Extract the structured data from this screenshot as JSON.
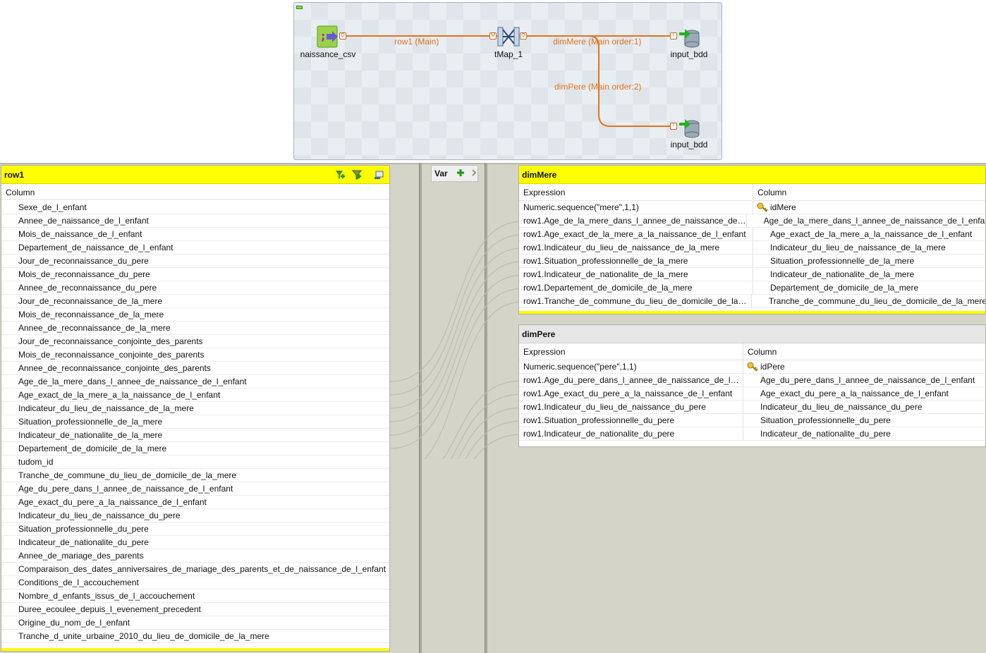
{
  "designer": {
    "components": [
      {
        "id": "naissance_csv",
        "label": "naissance_csv",
        "icon": "file-input-icon"
      },
      {
        "id": "tmap",
        "label": "tMap_1",
        "icon": "tmap-icon"
      },
      {
        "id": "out1",
        "label": "input_bdd",
        "icon": "database-output-icon"
      },
      {
        "id": "out2",
        "label": "input_bdd",
        "icon": "database-output-icon"
      }
    ],
    "links": [
      {
        "label": "row1 (Main)"
      },
      {
        "label": "dimMere (Main order:1)"
      },
      {
        "label": "dimPere (Main order:2)"
      }
    ],
    "ports": {
      "out_csv": "O",
      "in_tmap": "M",
      "out_tmap": "O",
      "in_out1": "I",
      "in_out2": "I"
    }
  },
  "input_table": {
    "title": "row1",
    "column_header": "Column",
    "rows": [
      "Sexe_de_l_enfant",
      "Annee_de_naissance_de_l_enfant",
      "Mois_de_naissance_de_l_enfant",
      "Departement_de_naissance_de_l_enfant",
      "Jour_de_reconnaissance_du_pere",
      "Mois_de_reconnaissance_du_pere",
      "Annee_de_reconnaissance_du_pere",
      "Jour_de_reconnaissance_de_la_mere",
      "Mois_de_reconnaissance_de_la_mere",
      "Annee_de_reconnaissance_de_la_mere",
      "Jour_de_reconnaissance_conjointe_des_parents",
      "Mois_de_reconnaissance_conjointe_des_parents",
      "Annee_de_reconnaissance_conjointe_des_parents",
      "Age_de_la_mere_dans_l_annee_de_naissance_de_l_enfant",
      "Age_exact_de_la_mere_a_la_naissance_de_l_enfant",
      "Indicateur_du_lieu_de_naissance_de_la_mere",
      "Situation_professionnelle_de_la_mere",
      "Indicateur_de_nationalite_de_la_mere",
      "Departement_de_domicile_de_la_mere",
      "tudom_id",
      "Tranche_de_commune_du_lieu_de_domicile_de_la_mere",
      "Age_du_pere_dans_l_annee_de_naissance_de_l_enfant",
      "Age_exact_du_pere_a_la_naissance_de_l_enfant",
      "Indicateur_du_lieu_de_naissance_du_pere",
      "Situation_professionnelle_du_pere",
      "Indicateur_de_nationalite_du_pere",
      "Annee_de_mariage_des_parents",
      "Comparaison_des_dates_anniversaires_de_mariage_des_parents_et_de_naissance_de_l_enfant",
      "Conditions_de_l_accouchement",
      "Nombre_d_enfants_issus_de_l_accouchement",
      "Duree_ecoulee_depuis_l_evenement_precedent",
      "Origine_du_nom_de_l_enfant",
      "Tranche_d_unite_urbaine_2010_du_lieu_de_domicile_de_la_mere"
    ]
  },
  "var_panel": {
    "title": "Var"
  },
  "output_tables": [
    {
      "title": "dimMere",
      "expression_header": "Expression",
      "column_header": "Column",
      "rows": [
        {
          "expr": "Numeric.sequence(\"mere\",1,1)",
          "col": "idMere",
          "key": true
        },
        {
          "expr": "row1.Age_de_la_mere_dans_l_annee_de_naissance_de_l_en...",
          "col": "Age_de_la_mere_dans_l_annee_de_naissance_de_l_enfant"
        },
        {
          "expr": "row1.Age_exact_de_la_mere_a_la_naissance_de_l_enfant",
          "col": "Age_exact_de_la_mere_a_la_naissance_de_l_enfant"
        },
        {
          "expr": "row1.Indicateur_du_lieu_de_naissance_de_la_mere",
          "col": "Indicateur_du_lieu_de_naissance_de_la_mere"
        },
        {
          "expr": "row1.Situation_professionnelle_de_la_mere",
          "col": "Situation_professionnelle_de_la_mere"
        },
        {
          "expr": "row1.Indicateur_de_nationalite_de_la_mere",
          "col": "Indicateur_de_nationalite_de_la_mere"
        },
        {
          "expr": "row1.Departement_de_domicile_de_la_mere",
          "col": "Departement_de_domicile_de_la_mere"
        },
        {
          "expr": "row1.Tranche_de_commune_du_lieu_de_domicile_de_la_m...",
          "col": "Tranche_de_commune_du_lieu_de_domicile_de_la_mere"
        }
      ]
    },
    {
      "title": "dimPere",
      "expression_header": "Expression",
      "column_header": "Column",
      "rows": [
        {
          "expr": "Numeric.sequence(\"pere\",1,1)",
          "col": "idPere",
          "key": true
        },
        {
          "expr": "row1.Age_du_pere_dans_l_annee_de_naissance_de_l_enf...",
          "col": "Age_du_pere_dans_l_annee_de_naissance_de_l_enfant"
        },
        {
          "expr": "row1.Age_exact_du_pere_a_la_naissance_de_l_enfant",
          "col": "Age_exact_du_pere_a_la_naissance_de_l_enfant"
        },
        {
          "expr": "row1.Indicateur_du_lieu_de_naissance_du_pere",
          "col": "Indicateur_du_lieu_de_naissance_du_pere"
        },
        {
          "expr": "row1.Situation_professionnelle_du_pere",
          "col": "Situation_professionnelle_du_pere"
        },
        {
          "expr": "row1.Indicateur_de_nationalite_du_pere",
          "col": "Indicateur_de_nationalite_du_pere"
        }
      ]
    }
  ],
  "colors": {
    "link_orange": "#e2731c",
    "header_yellow": "#ffff00",
    "mapper_bg": "#d4d4c8",
    "curve_grey": "#bdbdb2"
  }
}
